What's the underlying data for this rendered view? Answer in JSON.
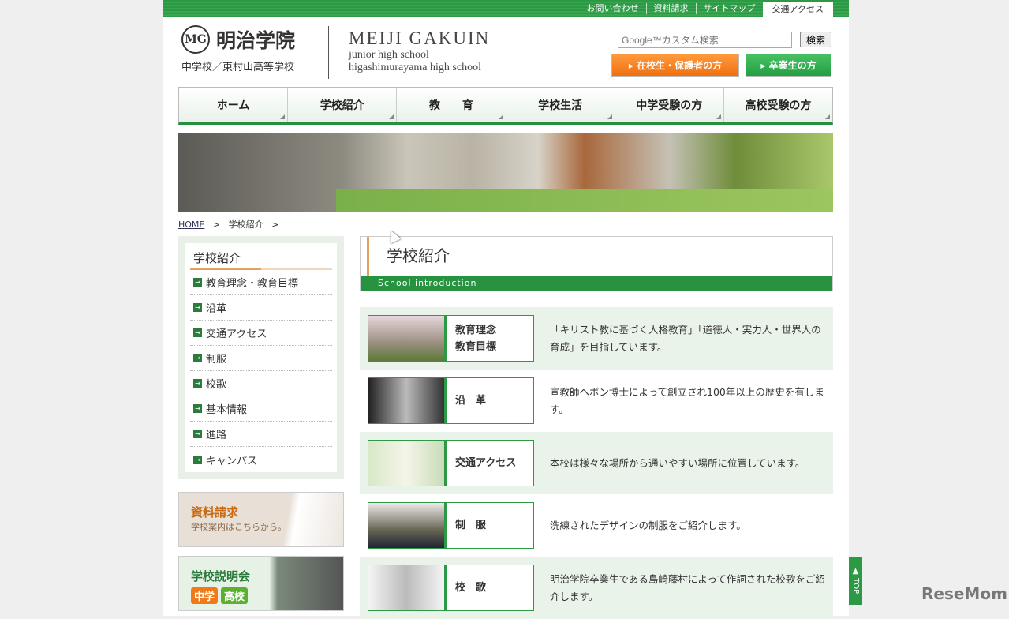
{
  "topbar": [
    "お問い合わせ",
    "資料請求",
    "サイトマップ",
    "交通アクセス"
  ],
  "logo": {
    "jp": "明治学院",
    "mark": "MG",
    "sub": "中学校／東村山高等学校",
    "en": "MEIJI GAKUIN",
    "en1": "junior high school",
    "en2": "higashimurayama high school"
  },
  "search": {
    "placeholder": "Google™カスタム検索",
    "button": "検索"
  },
  "buttons": {
    "students": "▸ 在校生・保護者の方",
    "alumni": "▸ 卒業生の方"
  },
  "nav": [
    "ホーム",
    "学校紹介",
    "教　　育",
    "学校生活",
    "中学受験の方",
    "高校受験の方"
  ],
  "breadcrumb": {
    "home": "HOME",
    "sep": ">",
    "current": "学校紹介",
    "sep2": ">"
  },
  "sidebar": {
    "title": "学校紹介",
    "items": [
      "教育理念・教育目標",
      "沿革",
      "交通アクセス",
      "制服",
      "校歌",
      "基本情報",
      "進路",
      "キャンパス"
    ]
  },
  "promo": {
    "req_title": "資料請求",
    "req_sub": "学校案内はこちらから。",
    "info_title": "学校説明会",
    "tag1": "中学",
    "tag2": "高校"
  },
  "page": {
    "title": "学校紹介",
    "subtitle": "School introduction"
  },
  "rows": [
    {
      "label": "教育理念\n教育目標",
      "desc": "「キリスト教に基づく人格教育」「道徳人・実力人・世界人の育成」を目指しています。"
    },
    {
      "label": "沿　革",
      "desc": "宣教師ヘボン博士によって創立され100年以上の歴史を有します。"
    },
    {
      "label": "交通アクセス",
      "desc": "本校は様々な場所から通いやすい場所に位置しています。"
    },
    {
      "label": "制　服",
      "desc": "洗練されたデザインの制服をご紹介します。"
    },
    {
      "label": "校　歌",
      "desc": "明治学院卒業生である島崎藤村によって作詞された校歌をご紹介します。"
    }
  ],
  "totop": "▲ TOP",
  "watermark": "ReseMom"
}
